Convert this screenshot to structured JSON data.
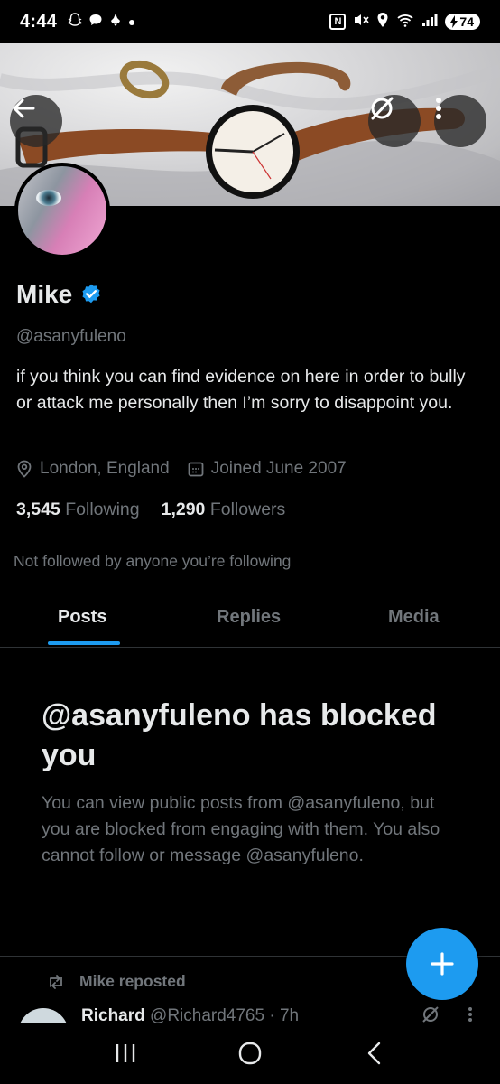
{
  "status_bar": {
    "time": "4:44",
    "battery": "74",
    "icons": [
      "snapchat-icon",
      "chat-icon",
      "notification-icon",
      "dot-icon",
      "nfc-icon",
      "mute-icon",
      "location-icon",
      "wifi-icon",
      "signal-icon"
    ]
  },
  "profile": {
    "name": "Mike",
    "verified": true,
    "handle": "@asanyfuleno",
    "bio": "if you think you can find evidence on here in order to bully or attack me personally then I’m sorry to disappoint you.",
    "location": "London, England",
    "joined": "Joined June 2007",
    "following_count": "3,545",
    "following_label": "Following",
    "followers_count": "1,290",
    "followers_label": "Followers",
    "not_followed": "Not followed by anyone you’re following"
  },
  "tabs": [
    {
      "label": "Posts",
      "active": true
    },
    {
      "label": "Replies",
      "active": false
    },
    {
      "label": "Media",
      "active": false
    }
  ],
  "blocked": {
    "title": "@asanyfuleno has blocked you",
    "body": "You can view public posts from @asanyfuleno, but you are blocked from engaging with them. You also cannot follow or message @asanyfuleno."
  },
  "feed": {
    "repost_label": "Mike reposted",
    "author_name": "Richard",
    "author_handle": "@Richard4765",
    "time": "· 7h"
  },
  "colors": {
    "accent": "#1d9bf0",
    "background": "#000000",
    "text_primary": "#e7e9ea",
    "text_secondary": "#71767b"
  }
}
